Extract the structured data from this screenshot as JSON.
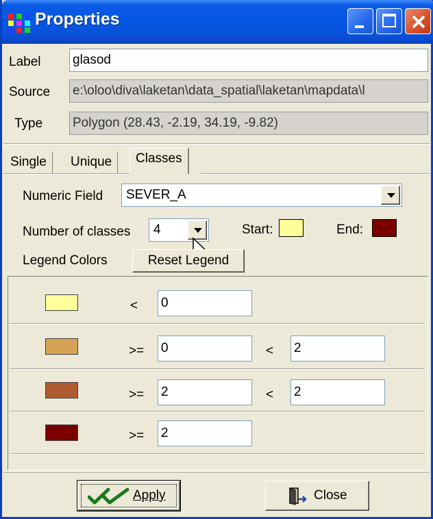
{
  "window": {
    "title": "Properties",
    "controls": [
      "minimize-icon",
      "maximize-icon",
      "close-icon"
    ]
  },
  "properties": {
    "label_caption": "Label",
    "label_value": "glasod",
    "source_caption": "Source",
    "source_value": "e:\\oloo\\diva\\laketan\\data_spatial\\laketan\\mapdata\\l",
    "type_caption": "Type",
    "type_value": "Polygon  (28.43, -2.19, 34.19, -9.82)"
  },
  "tabs": [
    {
      "label": "Single",
      "active": false
    },
    {
      "label": "Unique",
      "active": false
    },
    {
      "label": "Classes",
      "active": true
    }
  ],
  "classes": {
    "numeric_field_caption": "Numeric Field",
    "numeric_field_value": "SEVER_A",
    "num_classes_caption": "Number of classes",
    "num_classes_value": "4",
    "start_caption": "Start:",
    "end_caption": "End:",
    "start_color": "#ffff99",
    "end_color": "#7a0000",
    "legend_colors_caption": "Legend Colors",
    "reset_legend_label": "Reset Legend"
  },
  "legend_rows": [
    {
      "color": "#ffff99",
      "op1": "<",
      "val1": "0"
    },
    {
      "color": "#d4a454",
      "op1": ">=",
      "val1": "0",
      "op2": "<",
      "val2": "2"
    },
    {
      "color": "#b05a30",
      "op1": ">=",
      "val1": "2",
      "op2": "<",
      "val2": "2"
    },
    {
      "color": "#7a0000",
      "op1": ">=",
      "val1": "2"
    }
  ],
  "footer": {
    "apply_label": "Apply",
    "close_label": "Close"
  }
}
